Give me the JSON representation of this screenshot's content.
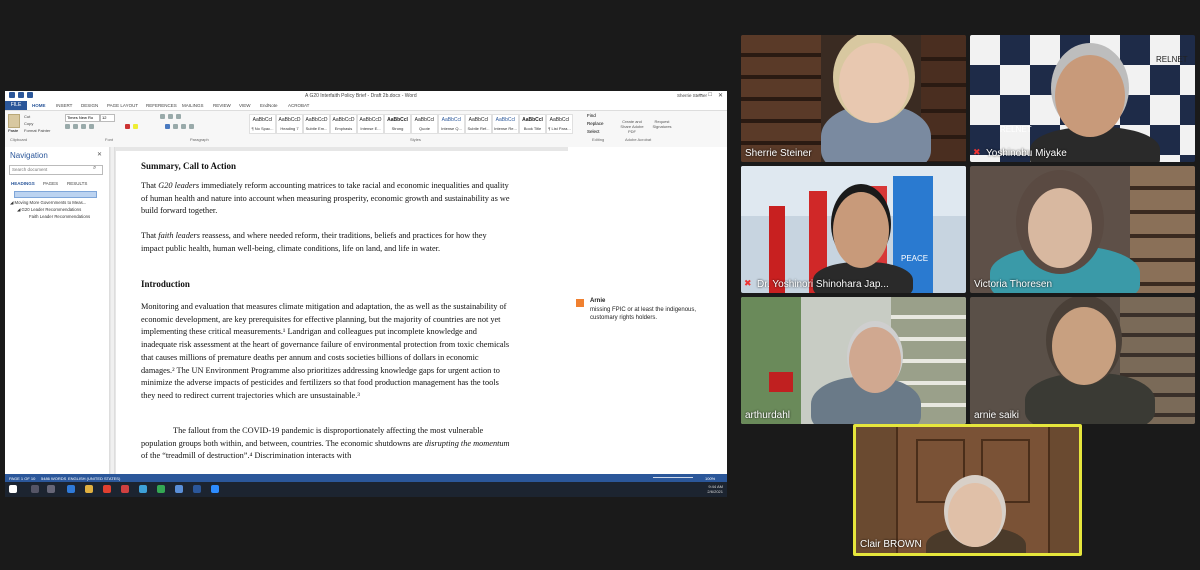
{
  "word": {
    "window_title": "A G20 Interfaith Policy Brief - Draft 2b.docx - Word",
    "user": "Sherrie Steiner",
    "menu_tabs": [
      "FILE",
      "HOME",
      "INSERT",
      "DESIGN",
      "PAGE LAYOUT",
      "REFERENCES",
      "MAILINGS",
      "REVIEW",
      "VIEW",
      "EndNote",
      "ACROBAT"
    ],
    "ribbon": {
      "paste": "Paste",
      "cut": "Cut",
      "copy": "Copy",
      "format_painter": "Format Painter",
      "font_name": "Times New Ro",
      "font_size": "12",
      "styles": [
        {
          "sample": "AaBbCcI",
          "name": "¶ No Spac..."
        },
        {
          "sample": "AaBbCcD",
          "name": "Heading 7"
        },
        {
          "sample": "AaBbCcD",
          "name": "Subtle Em..."
        },
        {
          "sample": "AaBbCcD",
          "name": "Emphasis"
        },
        {
          "sample": "AaBbCcD",
          "name": "Intense E..."
        },
        {
          "sample": "AaBbCcI",
          "name": "Strong"
        },
        {
          "sample": "AaBbCcI",
          "name": "Quote"
        },
        {
          "sample": "AaBbCcI",
          "name": "Intense Q..."
        },
        {
          "sample": "AaBbCcI",
          "name": "Subtle Ref..."
        },
        {
          "sample": "AaBbCcI",
          "name": "Intense Re..."
        },
        {
          "sample": "AaBbCcI",
          "name": "Book Title"
        },
        {
          "sample": "AaBbCcI",
          "name": "¶ List Para..."
        }
      ],
      "find": "Find",
      "replace": "Replace",
      "select": "Select",
      "create_share": "Create and Share Adobe PDF",
      "request_sig": "Request Signatures",
      "groups": [
        "Clipboard",
        "Font",
        "Paragraph",
        "Styles",
        "Editing",
        "Adobe Acrobat"
      ]
    },
    "nav": {
      "title": "Navigation",
      "search_placeholder": "Search document",
      "tabs": [
        "HEADINGS",
        "PAGES",
        "RESULTS"
      ],
      "items": [
        "Moving More Governments to Meas...",
        "G20 Leader Recommendations",
        "Faith Leader Recommendations"
      ]
    },
    "doc": {
      "heading1": "Summary, Call to Action",
      "p1_a": "That ",
      "p1_em": "G20 leaders",
      "p1_b": " immediately reform accounting matrices to take racial and economic inequalities and quality of human health and nature into account when measuring prosperity, economic growth and sustainability as we build forward together.",
      "p2_a": "That ",
      "p2_em": "faith leaders",
      "p2_b": " reassess, and where needed reform, their traditions, beliefs and practices for how they impact public health, human well-being, climate conditions, life on land, and life in water.",
      "heading2": "Introduction",
      "p3": "Monitoring and evaluation that measures climate mitigation and adaptation, the as well as the sustainability of economic development, are key prerequisites for effective planning, but the majority of countries are not yet implementing these critical measurements.¹ Landrigan and colleagues put incomplete knowledge and inadequate risk assessment at the heart of governance failure of environmental protection from toxic chemicals that causes millions of premature deaths per annum and costs societies billions of dollars in economic damages.² The UN Environment Programme also prioritizes addressing knowledge gaps for urgent action to minimize the adverse impacts of pesticides and fertilizers so that food production management has the tools they need to redirect current trajectories which are unsustainable.³",
      "p4_a": "The fallout from the COVID-19 pandemic is disproportionately affecting the most vulnerable population groups both within, and between, countries. The economic shutdowns are ",
      "p4_em": "disrupting the momentum",
      "p4_b": " of the “treadmill of destruction”.⁴ Discrimination interacts with"
    },
    "comment": {
      "author": "Arnie",
      "text": "missing FPIC or at least the indigenous, customary rights holders."
    },
    "status": {
      "page": "PAGE 1 OF 10",
      "words": "5486 WORDS",
      "lang": "ENGLISH (UNITED STATES)",
      "zoom": "100%"
    },
    "clock": {
      "time": "9:44 AM",
      "date": "2/6/2021"
    }
  },
  "participants": [
    {
      "name": "Sherrie Steiner",
      "muted": false
    },
    {
      "name": "Yoshinobu Miyake",
      "muted": true
    },
    {
      "name": "Dr. Yoshinori Shinohara Jap...",
      "muted": true
    },
    {
      "name": "Victoria Thoresen",
      "muted": false
    },
    {
      "name": "arthurdahl",
      "muted": false
    },
    {
      "name": "arnie saiki",
      "muted": false
    },
    {
      "name": "Clair BROWN",
      "muted": false
    }
  ],
  "backgrounds": {
    "relnet": "RELNET",
    "peace": "PEACE"
  },
  "colors": {
    "word_blue": "#2b579a",
    "active_speaker": "#e6e63c",
    "mute_red": "#e33333"
  }
}
